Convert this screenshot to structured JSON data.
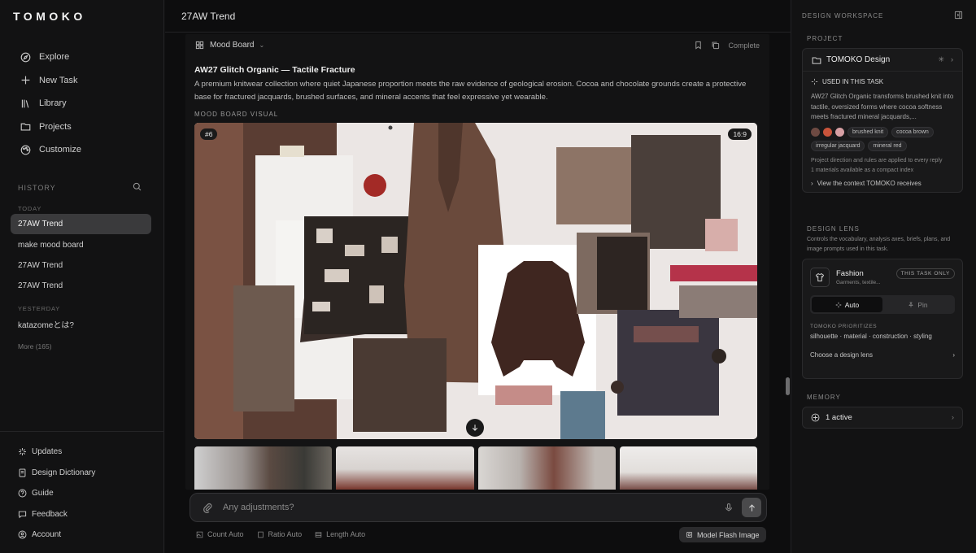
{
  "app": {
    "logo": "TOMOKO"
  },
  "nav": [
    {
      "label": "Explore",
      "icon": "compass-icon"
    },
    {
      "label": "New Task",
      "icon": "plus-icon"
    },
    {
      "label": "Library",
      "icon": "library-icon"
    },
    {
      "label": "Projects",
      "icon": "folder-icon"
    },
    {
      "label": "Customize",
      "icon": "palette-icon"
    }
  ],
  "history": {
    "label": "HISTORY",
    "today_label": "TODAY",
    "yesterday_label": "YESTERDAY",
    "items": [
      {
        "label": "27AW Trend",
        "active": true
      },
      {
        "label": "make mood board"
      },
      {
        "label": "27AW Trend"
      },
      {
        "label": "27AW Trend"
      },
      {
        "label": "katazomeとは?"
      }
    ],
    "more": "More (165)"
  },
  "bottom_nav": [
    {
      "label": "Updates",
      "icon": "sparkle-icon"
    },
    {
      "label": "Design Dictionary",
      "icon": "book-icon"
    },
    {
      "label": "Guide",
      "icon": "help-icon"
    },
    {
      "label": "Feedback",
      "icon": "chat-icon"
    },
    {
      "label": "Account",
      "icon": "user-icon"
    }
  ],
  "main": {
    "title": "27AW Trend",
    "doc_type": "Mood Board",
    "status": "Complete",
    "heading": "AW27 Glitch Organic — Tactile Fracture",
    "description": "A premium knitwear collection where quiet Japanese proportion meets the raw evidence of geological erosion. Cocoa and chocolate grounds create a protective base for fractured jacquards, brushed surfaces, and mineral accents that feel expressive yet wearable.",
    "visual_label": "MOOD BOARD VISUAL",
    "visual_index": "#6",
    "aspect": "16:9"
  },
  "composer": {
    "placeholder": "Any adjustments?",
    "count": "Count Auto",
    "ratio": "Ratio Auto",
    "length": "Length Auto",
    "model": "Model Flash Image"
  },
  "right": {
    "header": "DESIGN WORKSPACE",
    "project_label": "PROJECT",
    "project_name": "TOMOKO Design",
    "used_label": "USED IN THIS TASK",
    "used_text": "AW27 Glitch Organic transforms brushed knit into tactile, oversized forms where cocoa softness meets fractured mineral jacquards,...",
    "swatches": [
      "#6e4a42",
      "#c9543b",
      "#d7a0a4"
    ],
    "tags": [
      "brushed knit",
      "cocoa brown",
      "irregular jacquard",
      "mineral red"
    ],
    "note1": "Project direction and rules are applied to every reply",
    "note2": "1 materials available as a compact index",
    "view_context": "View the context TOMOKO receives",
    "lens_label": "DESIGN LENS",
    "lens_desc": "Controls the vocabulary, analysis axes, briefs, plans, and image prompts used in this task.",
    "lens_name": "Fashion",
    "lens_sub": "Garments, textile...",
    "lens_scope": "THIS TASK ONLY",
    "seg_auto": "Auto",
    "seg_pin": "Pin",
    "prioritizes_label": "TOMOKO PRIORITIZES",
    "prioritizes": "silhouette · material · construction · styling",
    "choose_lens": "Choose a design lens",
    "memory_label": "MEMORY",
    "memory_value": "1 active"
  }
}
